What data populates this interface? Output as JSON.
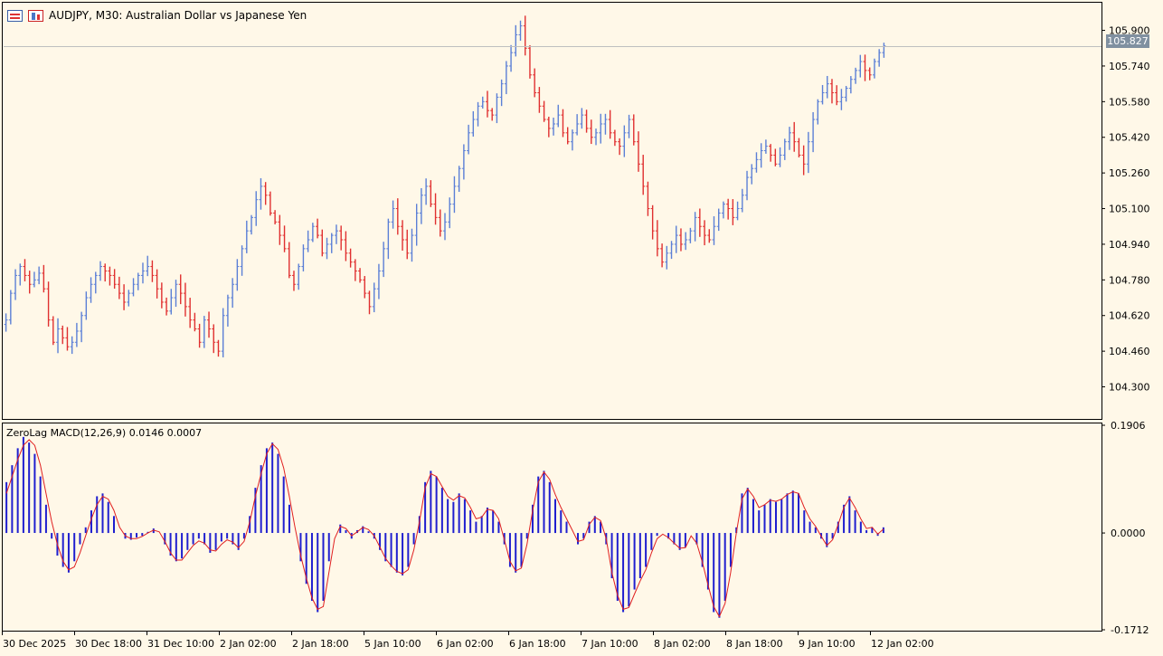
{
  "header": {
    "symbol_line": "AUDJPY, M30:  Australian Dollar vs Japanese Yen",
    "icons": [
      "chart-list-icon",
      "chart-bars-icon"
    ]
  },
  "current_price_label": "105.827",
  "indicator": {
    "label": "ZeroLag MACD(12,26,9) 0.0146 0.0007"
  },
  "colors": {
    "background": "#fff8e8",
    "bull": "#5b7fd6",
    "bear": "#e03030",
    "histogram": "#1f1fcf",
    "signal": "#e02020",
    "price_line": "#bfbfbf"
  },
  "chart_data": [
    {
      "type": "bar",
      "title": "AUDJPY, M30",
      "subtitle": "Australian Dollar vs Japanese Yen",
      "ylim": [
        104.16,
        106.02
      ],
      "yticks": [
        "105.900",
        "105.740",
        "105.580",
        "105.420",
        "105.260",
        "105.100",
        "104.940",
        "104.780",
        "104.620",
        "104.460",
        "104.300"
      ],
      "ytick_values": [
        105.9,
        105.74,
        105.58,
        105.42,
        105.26,
        105.1,
        104.94,
        104.78,
        104.62,
        104.46,
        104.3
      ],
      "current_price": 105.827,
      "xticks": [
        "30 Dec 2025",
        "30 Dec 18:00",
        "31 Dec 10:00",
        "2 Jan 02:00",
        "2 Jan 18:00",
        "5 Jan 10:00",
        "6 Jan 02:00",
        "6 Jan 18:00",
        "7 Jan 10:00",
        "8 Jan 02:00",
        "8 Jan 18:00",
        "9 Jan 10:00",
        "12 Jan 02:00"
      ],
      "closes": [
        104.6,
        104.72,
        104.8,
        104.84,
        104.8,
        104.76,
        104.78,
        104.81,
        104.74,
        104.6,
        104.5,
        104.56,
        104.52,
        104.48,
        104.5,
        104.55,
        104.62,
        104.7,
        104.76,
        104.8,
        104.84,
        104.82,
        104.8,
        104.76,
        104.72,
        104.68,
        104.72,
        104.76,
        104.8,
        104.82,
        104.84,
        104.8,
        104.74,
        104.68,
        104.64,
        104.7,
        104.76,
        104.72,
        104.66,
        104.6,
        104.56,
        104.5,
        104.6,
        104.56,
        104.5,
        104.46,
        104.62,
        104.7,
        104.76,
        104.84,
        104.92,
        105.0,
        105.06,
        105.14,
        105.2,
        105.16,
        105.08,
        105.04,
        104.98,
        104.92,
        104.8,
        104.76,
        104.84,
        104.92,
        104.96,
        105.02,
        104.98,
        104.9,
        104.94,
        104.98,
        105.0,
        104.96,
        104.9,
        104.86,
        104.82,
        104.78,
        104.72,
        104.66,
        104.74,
        104.82,
        104.92,
        105.04,
        105.1,
        105.02,
        104.96,
        104.9,
        104.98,
        105.08,
        105.16,
        105.2,
        105.12,
        105.06,
        105.0,
        105.04,
        105.12,
        105.2,
        105.28,
        105.36,
        105.44,
        105.5,
        105.56,
        105.58,
        105.54,
        105.52,
        105.6,
        105.66,
        105.74,
        105.8,
        105.88,
        105.92,
        105.82,
        105.7,
        105.62,
        105.56,
        105.5,
        105.46,
        105.48,
        105.52,
        105.44,
        105.4,
        105.44,
        105.48,
        105.52,
        105.46,
        105.42,
        105.44,
        105.48,
        105.5,
        105.44,
        105.4,
        105.38,
        105.44,
        105.5,
        105.4,
        105.3,
        105.2,
        105.1,
        105.0,
        104.92,
        104.86,
        104.9,
        104.94,
        104.98,
        104.94,
        104.96,
        105.0,
        105.06,
        105.02,
        104.98,
        104.96,
        105.02,
        105.08,
        105.12,
        105.1,
        105.06,
        105.1,
        105.16,
        105.24,
        105.28,
        105.32,
        105.36,
        105.38,
        105.34,
        105.3,
        105.34,
        105.4,
        105.44,
        105.4,
        105.34,
        105.3,
        105.4,
        105.5,
        105.58,
        105.62,
        105.66,
        105.62,
        105.58,
        105.6,
        105.64,
        105.68,
        105.72,
        105.76,
        105.72,
        105.7,
        105.76,
        105.8,
        105.83
      ]
    },
    {
      "type": "bar",
      "title": "ZeroLag MACD(12,26,9)",
      "ylim": [
        -0.1712,
        0.1906
      ],
      "yticks": [
        "0.1906",
        "0.0000",
        "-0.1712"
      ],
      "ytick_values": [
        0.1906,
        0.0,
        -0.1712
      ],
      "histogram": [
        0.09,
        0.12,
        0.15,
        0.17,
        0.16,
        0.14,
        0.1,
        0.05,
        -0.01,
        -0.04,
        -0.06,
        -0.07,
        -0.05,
        -0.02,
        0.01,
        0.04,
        0.065,
        0.07,
        0.055,
        0.03,
        0.0,
        -0.01,
        -0.012,
        -0.008,
        -0.005,
        0.002,
        0.008,
        0.0,
        -0.02,
        -0.04,
        -0.05,
        -0.045,
        -0.03,
        -0.02,
        -0.01,
        -0.02,
        -0.035,
        -0.03,
        -0.015,
        -0.01,
        -0.02,
        -0.03,
        -0.01,
        0.03,
        0.08,
        0.12,
        0.15,
        0.16,
        0.14,
        0.1,
        0.05,
        0.0,
        -0.05,
        -0.09,
        -0.12,
        -0.14,
        -0.12,
        -0.05,
        0.0,
        0.015,
        0.005,
        -0.01,
        0.005,
        0.012,
        0.003,
        -0.01,
        -0.03,
        -0.05,
        -0.06,
        -0.07,
        -0.075,
        -0.06,
        -0.02,
        0.03,
        0.09,
        0.11,
        0.1,
        0.08,
        0.06,
        0.055,
        0.07,
        0.06,
        0.04,
        0.02,
        0.03,
        0.045,
        0.04,
        0.02,
        -0.02,
        -0.06,
        -0.07,
        -0.06,
        -0.01,
        0.05,
        0.1,
        0.11,
        0.09,
        0.06,
        0.04,
        0.02,
        0.0,
        -0.02,
        -0.01,
        0.02,
        0.03,
        0.02,
        -0.02,
        -0.08,
        -0.12,
        -0.14,
        -0.13,
        -0.1,
        -0.08,
        -0.06,
        -0.03,
        -0.005,
        0.0,
        -0.01,
        -0.02,
        -0.03,
        -0.025,
        0.0,
        -0.02,
        -0.06,
        -0.1,
        -0.14,
        -0.15,
        -0.12,
        -0.06,
        0.01,
        0.07,
        0.08,
        0.06,
        0.04,
        0.05,
        0.06,
        0.055,
        0.06,
        0.07,
        0.075,
        0.07,
        0.04,
        0.02,
        0.01,
        -0.01,
        -0.025,
        -0.01,
        0.02,
        0.05,
        0.065,
        0.04,
        0.02,
        0.005,
        0.01,
        -0.005,
        0.01
      ],
      "signal": [
        0.07,
        0.1,
        0.13,
        0.155,
        0.165,
        0.155,
        0.12,
        0.07,
        0.02,
        -0.02,
        -0.05,
        -0.065,
        -0.06,
        -0.035,
        -0.005,
        0.025,
        0.05,
        0.065,
        0.06,
        0.04,
        0.01,
        -0.005,
        -0.01,
        -0.01,
        -0.006,
        0.0,
        0.005,
        0.002,
        -0.015,
        -0.035,
        -0.048,
        -0.048,
        -0.035,
        -0.022,
        -0.014,
        -0.018,
        -0.03,
        -0.032,
        -0.02,
        -0.012,
        -0.016,
        -0.026,
        -0.015,
        0.02,
        0.065,
        0.105,
        0.14,
        0.158,
        0.148,
        0.115,
        0.065,
        0.01,
        -0.04,
        -0.08,
        -0.115,
        -0.135,
        -0.13,
        -0.07,
        -0.01,
        0.012,
        0.008,
        -0.005,
        0.002,
        0.01,
        0.006,
        -0.005,
        -0.025,
        -0.045,
        -0.058,
        -0.068,
        -0.072,
        -0.065,
        -0.03,
        0.02,
        0.08,
        0.105,
        0.1,
        0.082,
        0.065,
        0.058,
        0.066,
        0.062,
        0.045,
        0.025,
        0.028,
        0.042,
        0.04,
        0.025,
        -0.012,
        -0.05,
        -0.067,
        -0.062,
        -0.02,
        0.04,
        0.09,
        0.108,
        0.095,
        0.068,
        0.045,
        0.025,
        0.005,
        -0.015,
        -0.012,
        0.015,
        0.028,
        0.022,
        -0.01,
        -0.07,
        -0.11,
        -0.135,
        -0.132,
        -0.108,
        -0.085,
        -0.065,
        -0.035,
        -0.01,
        -0.002,
        -0.008,
        -0.018,
        -0.027,
        -0.026,
        -0.005,
        -0.018,
        -0.052,
        -0.092,
        -0.13,
        -0.148,
        -0.125,
        -0.07,
        0.0,
        0.06,
        0.078,
        0.065,
        0.045,
        0.05,
        0.058,
        0.056,
        0.06,
        0.068,
        0.073,
        0.07,
        0.045,
        0.025,
        0.012,
        -0.006,
        -0.022,
        -0.012,
        0.015,
        0.045,
        0.062,
        0.045,
        0.025,
        0.008,
        0.01,
        -0.002,
        0.007
      ]
    }
  ]
}
